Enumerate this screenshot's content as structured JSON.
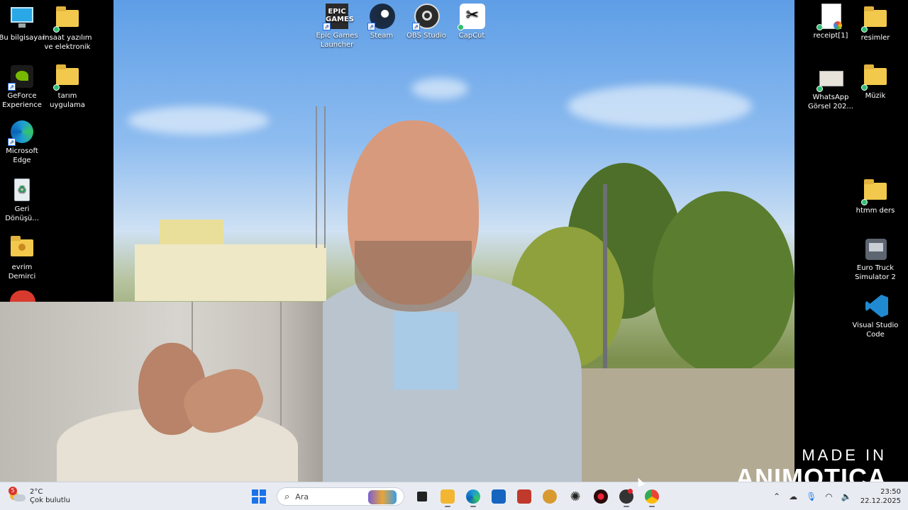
{
  "desktop": {
    "left_icons": [
      {
        "label": "Bu bilgisayar",
        "icon": "computer-icon"
      },
      {
        "label": "insaat yazılım ve elektronik",
        "icon": "folder-icon"
      },
      {
        "label": "GeForce Experience",
        "icon": "geforce-icon"
      },
      {
        "label": "tarım uygulama",
        "icon": "folder-icon"
      },
      {
        "label": "Microsoft Edge",
        "icon": "edge-icon"
      },
      {
        "label": "Geri Dönüşü...",
        "icon": "recycle-bin-icon"
      },
      {
        "label": "evrim Demirci",
        "icon": "user-folder-icon"
      }
    ],
    "top_icons": [
      {
        "label": "Epic Games Launcher",
        "icon": "epic-games-icon",
        "badge": "EPIC GAMES"
      },
      {
        "label": "Steam",
        "icon": "steam-icon"
      },
      {
        "label": "OBS Studio",
        "icon": "obs-icon"
      },
      {
        "label": "CapCut",
        "icon": "capcut-icon"
      }
    ],
    "right_icons": [
      {
        "label": "receipt[1]",
        "icon": "pdf-document-icon"
      },
      {
        "label": "resimler",
        "icon": "folder-icon"
      },
      {
        "label": "WhatsApp Görsel 202...",
        "icon": "image-file-icon"
      },
      {
        "label": "Müzik",
        "icon": "folder-icon"
      },
      {
        "label": "htmm ders",
        "icon": "folder-icon"
      },
      {
        "label": "Euro Truck Simulator 2",
        "icon": "truck-game-icon"
      },
      {
        "label": "Visual Studio Code",
        "icon": "vscode-icon"
      }
    ]
  },
  "watermark": {
    "line1": "MADE IN",
    "line2": "ANIMOTICA"
  },
  "taskbar": {
    "weather": {
      "temp": "2°C",
      "desc": "Çok bulutlu",
      "badge": "5"
    },
    "search_placeholder": "Ara",
    "apps": [
      {
        "name": "task-view",
        "icon": "task-view-icon"
      },
      {
        "name": "file-explorer",
        "icon": "folder-icon",
        "color": "#f2b632"
      },
      {
        "name": "edge",
        "icon": "edge-icon",
        "color": "#1d9bd6"
      },
      {
        "name": "microsoft-store",
        "icon": "store-icon",
        "color": "#1565c0"
      },
      {
        "name": "app-red",
        "icon": "game-icon",
        "color": "#c0392b"
      },
      {
        "name": "app-gear",
        "icon": "gear-app-icon",
        "color": "#d89a2f"
      },
      {
        "name": "chatgpt",
        "icon": "chatgpt-icon",
        "color": "#222222"
      },
      {
        "name": "recorder",
        "icon": "record-icon",
        "color": "#8b1a1a"
      },
      {
        "name": "obs",
        "icon": "obs-icon",
        "color": "#333333"
      },
      {
        "name": "chrome",
        "icon": "chrome-icon",
        "color": "#34a853"
      }
    ],
    "clock": {
      "time": "23:50",
      "date": "22.12.2025"
    }
  }
}
